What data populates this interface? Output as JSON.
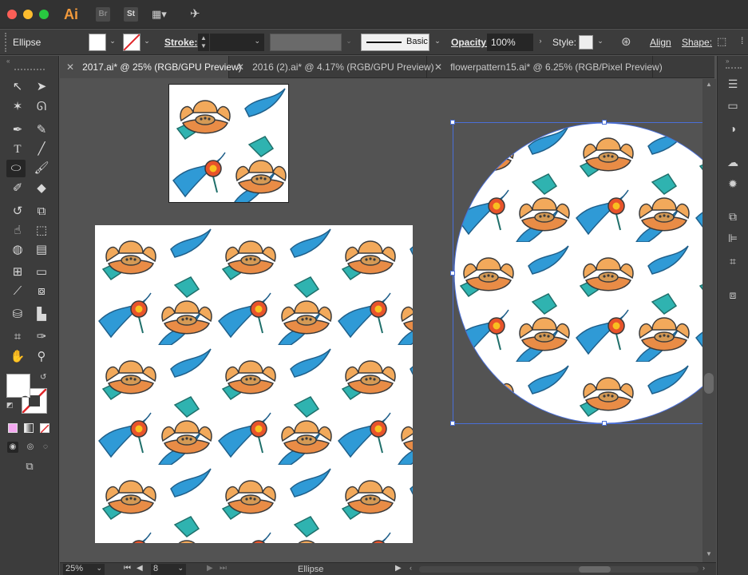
{
  "app": {
    "badges": [
      "Ai",
      "Br",
      "St"
    ]
  },
  "control_bar": {
    "object_type": "Ellipse",
    "stroke_label": "Stroke:",
    "brush_label": "Basic",
    "opacity_label": "Opacity:",
    "opacity_value": "100%",
    "style_label": "Style:",
    "align_label": "Align",
    "shape_label": "Shape:"
  },
  "tabs": [
    {
      "label": "2017.ai* @ 25% (RGB/GPU Preview)",
      "active": true
    },
    {
      "label": "2016 (2).ai* @ 4.17% (RGB/GPU Preview)",
      "active": false
    },
    {
      "label": "flowerpattern15.ai* @ 6.25% (RGB/Pixel Preview)",
      "active": false
    }
  ],
  "status_bar": {
    "zoom": "25%",
    "artboard": "8",
    "current_tool": "Ellipse"
  },
  "colors": {
    "accent_selection": "#4a6fd8",
    "lotus_petal": "#f2a95b",
    "lotus_dark": "#e98c46",
    "leaf_blue": "#2f9ad6",
    "leaf_teal": "#2fb3b0",
    "bud_red": "#e8532a",
    "bud_yellow": "#f8c020",
    "outline": "#3a3a3a"
  },
  "icons": {
    "tools": [
      "selection-icon",
      "direct-selection-icon",
      "magic-wand-icon",
      "lasso-icon",
      "pen-icon",
      "curvature-icon",
      "type-icon",
      "line-icon",
      "ellipse-icon",
      "paintbrush-icon",
      "shaper-icon",
      "eraser-icon",
      "rotate-icon",
      "scale-icon",
      "warp-icon",
      "free-transform-icon",
      "shape-builder-icon",
      "perspective-icon",
      "mesh-icon",
      "gradient-icon",
      "eyedropper-icon",
      "blend-icon",
      "symbol-sprayer-icon",
      "graph-icon",
      "artboard-icon",
      "slice-icon",
      "hand-icon",
      "zoom-icon"
    ],
    "dock": [
      "properties-icon",
      "gradient-panel-icon",
      "transparency-icon",
      "libraries-icon",
      "appearance-icon",
      "pathfinder-icon",
      "align-icon",
      "transform-icon",
      "artboards-icon"
    ]
  }
}
